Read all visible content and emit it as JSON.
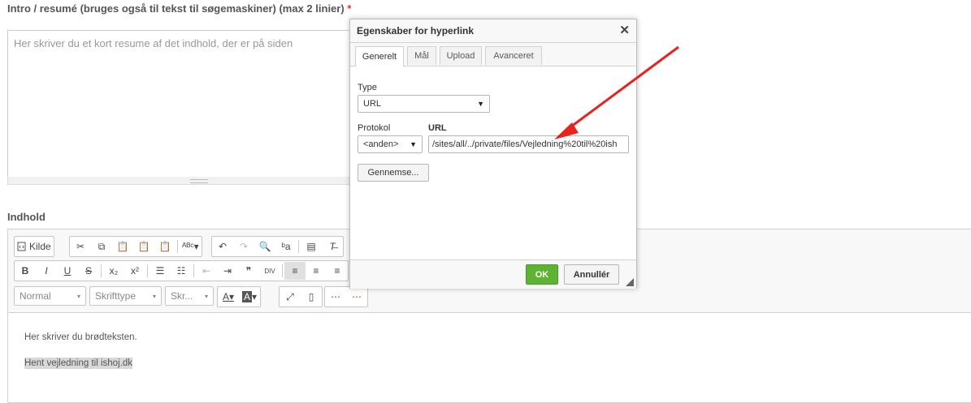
{
  "intro": {
    "label": "Intro / resumé (bruges også til tekst til søgemaskiner) (max 2 linier)",
    "required_mark": "*",
    "placeholder": "Her skriver du et kort resume af det indhold, der er på siden"
  },
  "content": {
    "label": "Indhold",
    "toolbar": {
      "source_label": "Kilde",
      "bold": "B",
      "italic": "I",
      "underline": "U",
      "strike": "S",
      "subscript": "x₂",
      "superscript": "x²",
      "blockquote": "❞",
      "div": "DIV",
      "format": "Normal",
      "font": "Skrifttype",
      "size": "Skr..."
    },
    "paragraphs": [
      "Her skriver du brødteksten.",
      "Hent vejledning til ishoj.dk"
    ]
  },
  "dialog": {
    "title": "Egenskaber for hyperlink",
    "close": "✕",
    "tabs": [
      "Generelt",
      "Mål",
      "Upload",
      "Avanceret"
    ],
    "active_tab": "Generelt",
    "type_label": "Type",
    "type_value": "URL",
    "protocol_label": "Protokol",
    "protocol_value": "<anden>",
    "url_label": "URL",
    "url_value": "/sites/all/../private/files/Vejledning%20til%20ish",
    "browse": "Gennemse...",
    "ok": "OK",
    "cancel": "Annullér"
  },
  "colors": {
    "ok_button": "#5fb332",
    "arrow": "#e8221e",
    "required": "#dd3333"
  }
}
